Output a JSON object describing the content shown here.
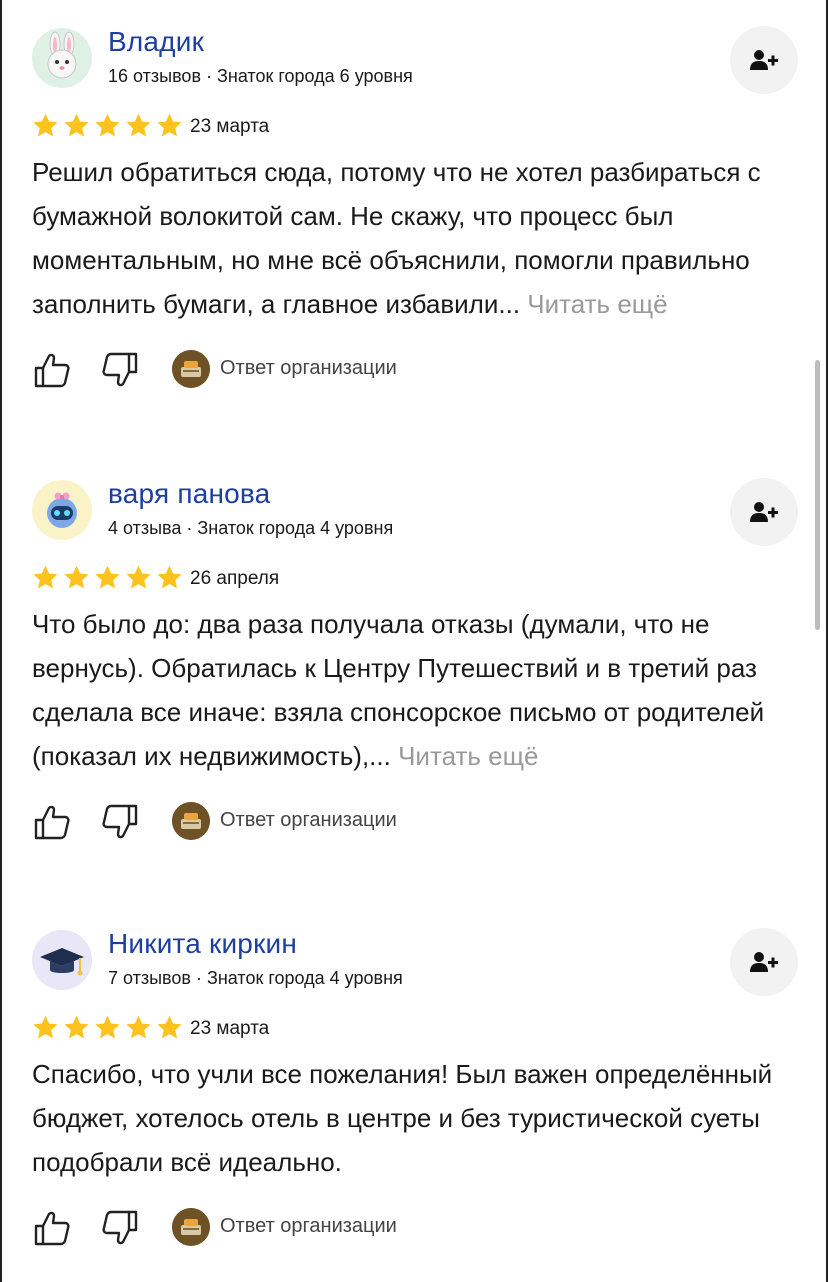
{
  "reviews": [
    {
      "author": "Владик",
      "meta": "16 отзывов · Знаток города 6 уровня",
      "avatar_icon": "bunny-icon",
      "rating": 5,
      "date": "23 марта",
      "text": "Решил обратиться сюда, потому что не хотел разбираться с бумажной волокитой сам. Не скажу, что процесс был моментальным, но мне всё объяснили, помогли правильно заполнить бумаги, а главное избавили...",
      "read_more": "Читать ещё",
      "org_answer": "Ответ организации"
    },
    {
      "author": "варя панова",
      "meta": "4 отзыва · Знаток города 4 уровня",
      "avatar_icon": "robot-icon",
      "rating": 5,
      "date": "26 апреля",
      "text": "Что было до: два раза получала отказы (думали, что не вернусь). Обратилась к Центру Путешествий и в третий раз сделала все иначе: взяла спонсорское письмо от родителей (показал их недвижимость),...",
      "read_more": "Читать ещё",
      "org_answer": "Ответ организации"
    },
    {
      "author": "Никита киркин",
      "meta": "7 отзывов · Знаток города 4 уровня",
      "avatar_icon": "graduation-cap-icon",
      "rating": 5,
      "date": "23 марта",
      "text": "Спасибо, что учли все пожелания! Был важен определённый бюджет, хотелось отель в центре и без туристической суеты подобрали всё идеально.",
      "read_more": "",
      "org_answer": "Ответ организации"
    }
  ],
  "colors": {
    "author_name": "#1d3f9e",
    "star": "#fcc31e",
    "read_more": "#9a9a9a",
    "subscribe_bg": "#f2f2f2"
  }
}
